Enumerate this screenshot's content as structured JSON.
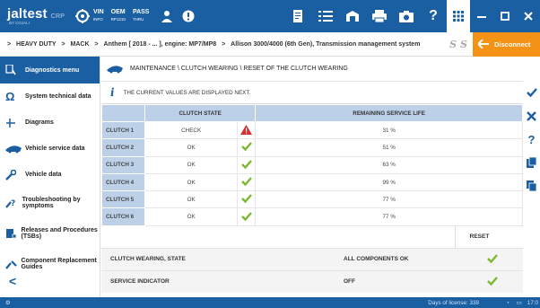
{
  "app": {
    "brand": "jaltest",
    "brand_tag": "CRP",
    "brand_sub": "BY COJALI",
    "vin_label": "VIN",
    "vin_sub": "INFO",
    "oem_label": "OEM",
    "oem_sub": "RP1210",
    "pass_label": "PASS",
    "pass_sub": "THRU"
  },
  "breadcrumb": [
    "HEAVY DUTY",
    "MACK",
    "Anthem [ 2018 - ... ], engine: MP7/MP8",
    "Allison 3000/4000 (6th Gen), Transmission management system"
  ],
  "disconnect_label": "Disconnect",
  "sidebar": {
    "items": [
      {
        "label": "Diagnostics menu",
        "icon": "diagnostics-icon"
      },
      {
        "label": "System technical data",
        "icon": "omega-icon"
      },
      {
        "label": "Diagrams",
        "icon": "diagram-icon"
      },
      {
        "label": "Vehicle service data",
        "icon": "truck-icon"
      },
      {
        "label": "Vehicle data",
        "icon": "wrench-icon"
      },
      {
        "label": "Troubleshooting by symptoms",
        "icon": "troubleshoot-icon"
      },
      {
        "label": "Releases and Procedures (TSBs)",
        "icon": "tsb-icon"
      },
      {
        "label": "Component Replacement Guides",
        "icon": "component-icon"
      }
    ]
  },
  "main": {
    "title": "MAINTENANCE \\ CLUTCH WEARING \\ RESET OF THE CLUTCH WEARING",
    "info": "THE CURRENT VALUES ARE DISPLAYED NEXT.",
    "table": {
      "headers": [
        "CLUTCH STATE",
        "REMAINING SERVICE LIFE"
      ],
      "rows": [
        {
          "label": "CLUTCH 1",
          "state": "CHECK",
          "status": "warning",
          "life": "31 %"
        },
        {
          "label": "CLUTCH 2",
          "state": "OK",
          "status": "ok",
          "life": "51 %"
        },
        {
          "label": "CLUTCH 3",
          "state": "OK",
          "status": "ok",
          "life": "63 %"
        },
        {
          "label": "CLUTCH 4",
          "state": "OK",
          "status": "ok",
          "life": "99 %"
        },
        {
          "label": "CLUTCH 5",
          "state": "OK",
          "status": "ok",
          "life": "77 %"
        },
        {
          "label": "CLUTCH 6",
          "state": "OK",
          "status": "ok",
          "life": "77 %"
        }
      ]
    },
    "reset_label": "RESET",
    "summary": [
      {
        "label": "CLUTCH WEARING, STATE",
        "value": "ALL COMPONENTS OK"
      },
      {
        "label": "SERVICE INDICATOR",
        "value": "OFF"
      }
    ]
  },
  "status": {
    "license": "Days of license: 338",
    "time": "17:0"
  },
  "colors": {
    "primary": "#1b5fa3",
    "accent": "#f39214",
    "ok": "#7cb82f",
    "warn": "#d32f2f",
    "header_cell": "#bcd1e8"
  }
}
